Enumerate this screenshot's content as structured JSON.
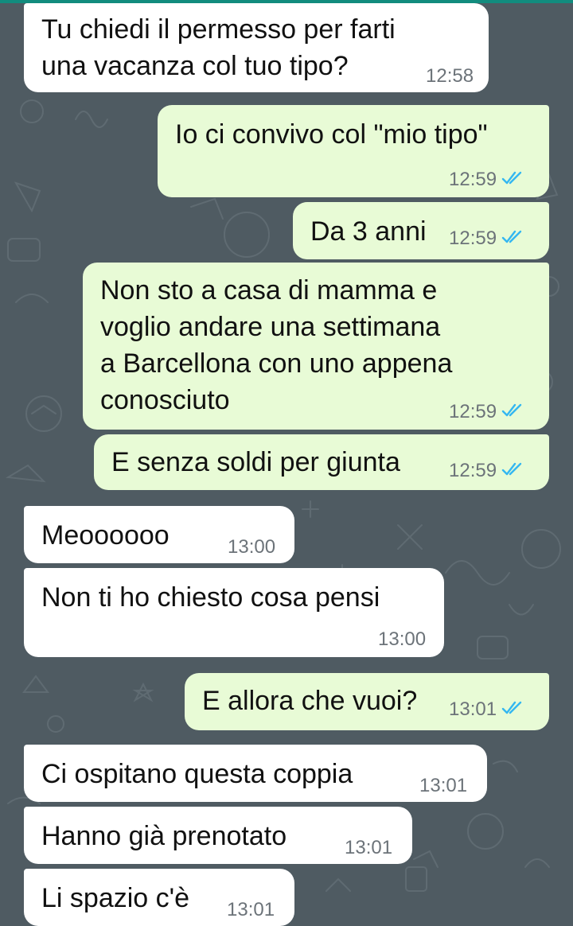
{
  "colors": {
    "wallpaper": "#4f5b62",
    "incoming_bubble": "#ffffff",
    "outgoing_bubble": "#e8fbd6",
    "timestamp": "#6c7379",
    "read_tick": "#34b7f1",
    "header_strip": "#128c7e"
  },
  "icons": {
    "read_receipt": "double-check-icon"
  },
  "messages": [
    {
      "direction": "incoming",
      "text": "Tu chiedi il permesso per farti\nuna vacanza col tuo tipo?",
      "time": "12:58"
    },
    {
      "direction": "outgoing",
      "text": "Io ci convivo col \"mio tipo\"",
      "time": "12:59",
      "read": true
    },
    {
      "direction": "outgoing",
      "text": "Da 3 anni",
      "time": "12:59",
      "read": true
    },
    {
      "direction": "outgoing",
      "text": "Non sto a casa di mamma e\nvoglio andare una settimana\na Barcellona con uno appena\nconosciuto",
      "time": "12:59",
      "read": true
    },
    {
      "direction": "outgoing",
      "text": "E senza soldi per giunta",
      "time": "12:59",
      "read": true
    },
    {
      "direction": "incoming",
      "text": "Meoooooo",
      "time": "13:00"
    },
    {
      "direction": "incoming",
      "text": "Non ti ho chiesto cosa pensi",
      "time": "13:00"
    },
    {
      "direction": "outgoing",
      "text": "E allora che vuoi?",
      "time": "13:01",
      "read": true
    },
    {
      "direction": "incoming",
      "text": "Ci ospitano questa coppia",
      "time": "13:01"
    },
    {
      "direction": "incoming",
      "text": "Hanno già prenotato",
      "time": "13:01"
    },
    {
      "direction": "incoming",
      "text": "Li spazio c'è",
      "time": "13:01"
    }
  ]
}
